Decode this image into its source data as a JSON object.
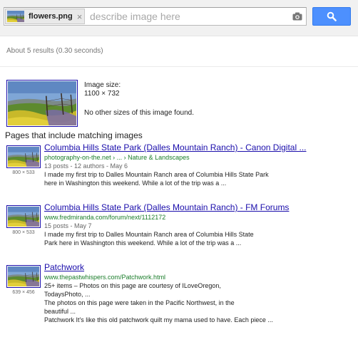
{
  "search": {
    "chip_filename": "flowers.png",
    "chip_close_glyph": "×",
    "placeholder": "describe image here",
    "value": ""
  },
  "results_stats": "About 5 results (0.30 seconds)",
  "image_info": {
    "size_label": "Image size:",
    "size_value": "1100 × 732",
    "no_sizes": "No other sizes of this image found."
  },
  "pages_heading": "Pages that include matching images",
  "results": [
    {
      "title": "Columbia Hills State Park (Dalles Mountain Ranch) - Canon Digital ...",
      "url": "photography-on-the.net › ... › Nature & Landscapes",
      "meta": "13 posts - 12 authors - May 6",
      "snippet1": "I made my first trip to Dalles Mountain Ranch area of Columbia Hills State Park",
      "snippet2": "here in Washington this weekend. While a lot of the trip was a ...",
      "snippet3": "",
      "snippet4": "",
      "snippet5": "",
      "dims": "800 × 533"
    },
    {
      "title": "Columbia Hills State Park (Dalles Mountain Ranch) - FM Forums",
      "url": "www.fredmiranda.com/forum/next/1112172",
      "meta": "15 posts - May 7",
      "snippet1": "I made my first trip to Dalles Mountain Ranch area of Columbia Hills State",
      "snippet2": "Park here in Washington this weekend. While a lot of the trip was a ...",
      "snippet3": "",
      "snippet4": "",
      "snippet5": "",
      "dims": "800 × 533"
    },
    {
      "title": "Patchwork",
      "url": "www.thepastwhispers.com/Patchwork.html",
      "meta": "",
      "snippet1": "25+ items – Photos on this page are courtesy of ILoveOregon,",
      "snippet2": "TodaysPhoto, ...",
      "snippet3": "The photos on this page were taken in the Pacific Northwest, in the",
      "snippet4": "beautiful ...",
      "snippet5": "Patchwork It's like this old patchwork quilt my mama used to have. Each piece ...",
      "dims": "639 × 456"
    }
  ],
  "icons": {
    "camera": "camera-icon",
    "search": "search-icon",
    "close": "close-icon"
  },
  "colors": {
    "link": "#1a0dab",
    "url": "#1a7d2a",
    "button": "#4d90fe"
  }
}
